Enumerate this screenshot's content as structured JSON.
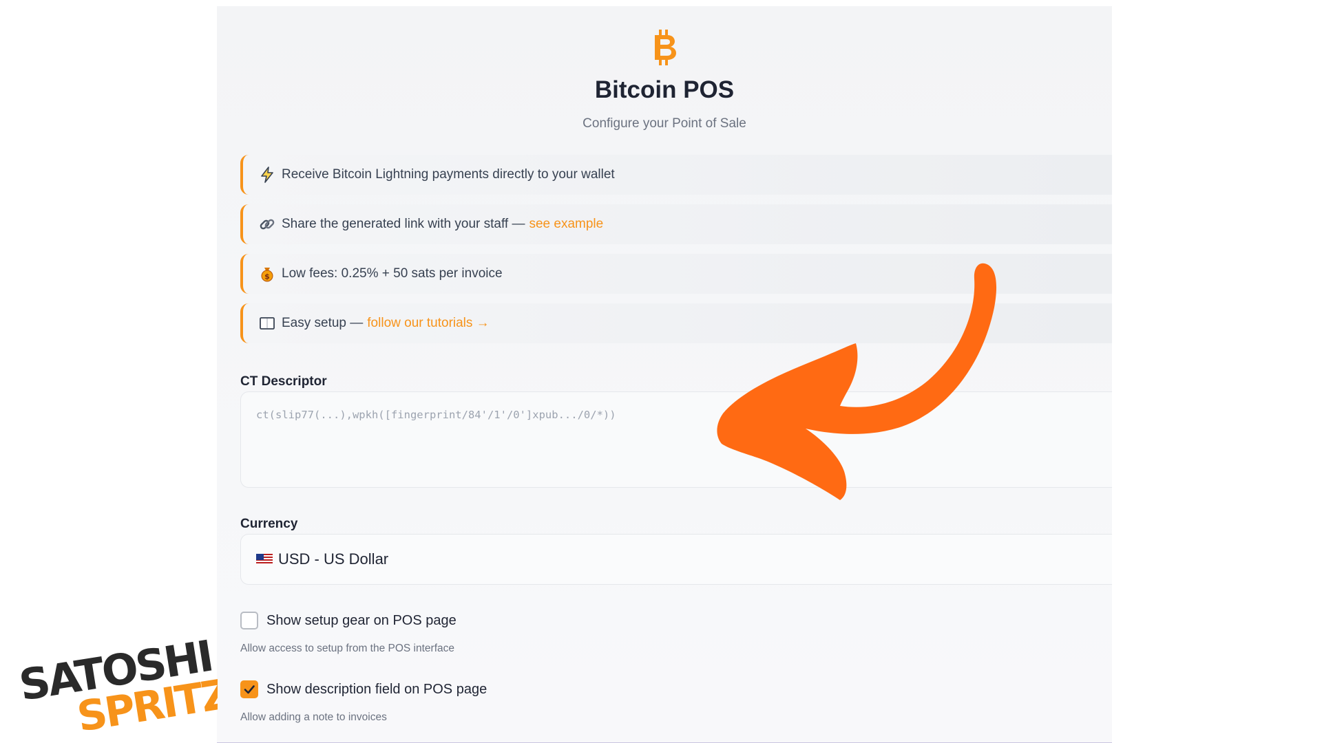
{
  "app": {
    "title": "Bitcoin POS",
    "subtitle": "Configure your Point of Sale",
    "logo_icon": "bitcoin-icon",
    "accent_color": "#f7931a"
  },
  "features": [
    {
      "icon": "lightning-icon",
      "text": "Receive Bitcoin Lightning payments directly to your wallet",
      "link": ""
    },
    {
      "icon": "link-icon",
      "text": "Share the generated link with your staff —",
      "link": "see example"
    },
    {
      "icon": "money-bag-icon",
      "text": "Low fees: 0.25% + 50 sats per invoice",
      "link": ""
    },
    {
      "icon": "book-icon",
      "text": "Easy setup —",
      "link": "follow our tutorials →"
    }
  ],
  "ct_descriptor": {
    "label": "CT Descriptor",
    "placeholder": "ct(slip77(...),wpkh([fingerprint/84'/1'/0']xpub.../0/*))",
    "value": ""
  },
  "currency": {
    "label": "Currency",
    "flag_icon": "us-flag-icon",
    "selected": "USD - US Dollar"
  },
  "options": [
    {
      "label": "Show setup gear on POS page",
      "hint": "Allow access to setup from the POS interface",
      "checked": false
    },
    {
      "label": "Show description field on POS page",
      "hint": "Allow adding a note to invoices",
      "checked": true
    }
  ],
  "overlay": {
    "arrow_color": "#ff6a13",
    "brand_line1": "SATOSHI",
    "brand_line2": "SPRITZ",
    "brand_color_dark": "#2a2a2a",
    "brand_color_orange": "#f7931a"
  }
}
